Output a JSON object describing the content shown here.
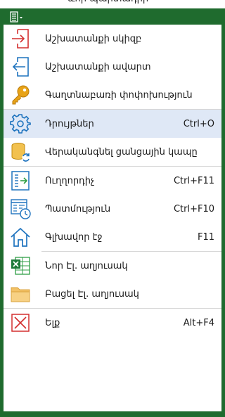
{
  "menu": {
    "items": [
      {
        "label": "Աշխատանքի սկիզբ",
        "shortcut": ""
      },
      {
        "label": "Աշխատանքի ավարտ",
        "shortcut": ""
      },
      {
        "label": "Գաղտնաբառի փոփոխություն",
        "shortcut": ""
      },
      {
        "label": "Դրույթներ",
        "shortcut": "Ctrl+O"
      },
      {
        "label": "Վերականգնել ցանցային կապը",
        "shortcut": ""
      },
      {
        "label": "Ուղղորդիչ",
        "shortcut": "Ctrl+F11"
      },
      {
        "label": "Պատմություն",
        "shortcut": "Ctrl+F10"
      },
      {
        "label": "Գլխավոր էջ",
        "shortcut": "F11"
      },
      {
        "label": "Նոր Էլ. աղյուսակ",
        "shortcut": ""
      },
      {
        "label": "Բացել Էլ. աղյուսակ",
        "shortcut": ""
      },
      {
        "label": "Ելք",
        "shortcut": "Alt+F4"
      }
    ]
  },
  "colors": {
    "header_bg": "#1f6b2e",
    "hover_bg": "#dfe8f6",
    "red": "#d32f2f",
    "blue": "#1e73be",
    "gold": "#e8a317"
  }
}
